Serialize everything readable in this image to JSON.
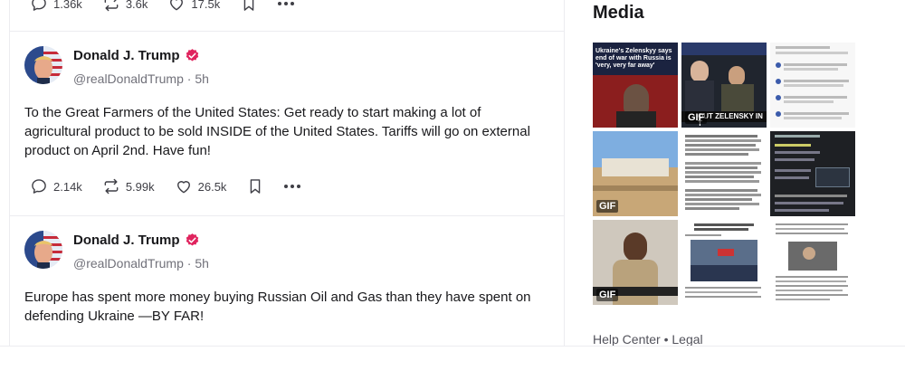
{
  "previous_post": {
    "replies": "1.36k",
    "reposts": "3.6k",
    "likes": "17.5k"
  },
  "posts": [
    {
      "display_name": "Donald J. Trump",
      "handle": "@realDonaldTrump",
      "separator": "·",
      "time": "5h",
      "text": "To the Great Farmers of the United States: Get ready to start making a lot of agricultural product to be sold INSIDE of the United States. Tariffs will go on external product on April 2nd. Have fun!",
      "replies": "2.14k",
      "reposts": "5.99k",
      "likes": "26.5k"
    },
    {
      "display_name": "Donald J. Trump",
      "handle": "@realDonaldTrump",
      "separator": "·",
      "time": "5h",
      "text": "Europe has spent more money buying Russian Oil and Gas than they have spent on defending Ukraine —BY FAR!"
    }
  ],
  "sidebar": {
    "media_title": "Media",
    "thumbnails": [
      {
        "caption": "Ukraine's Zelenskyy says end of war with Russia is 'very, very far away'",
        "gif": ""
      },
      {
        "caption": "OUT ZELENSKY IN T",
        "gif": "GIF"
      },
      {
        "caption": "",
        "gif": ""
      },
      {
        "caption": "",
        "gif": "GIF"
      },
      {
        "caption": "",
        "gif": ""
      },
      {
        "caption": "",
        "gif": ""
      },
      {
        "caption": "",
        "gif": "GIF"
      },
      {
        "caption": "",
        "gif": ""
      },
      {
        "caption": "",
        "gif": ""
      }
    ],
    "footer": {
      "help": "Help Center",
      "dot": "•",
      "legal": "Legal"
    }
  },
  "colors": {
    "verified": "#e0245e",
    "text": "#18181b",
    "muted": "#71717a",
    "divider": "#ececf0"
  },
  "icons": [
    "reply-icon",
    "repost-icon",
    "like-icon",
    "bookmark-icon",
    "more-icon",
    "verified-icon"
  ]
}
